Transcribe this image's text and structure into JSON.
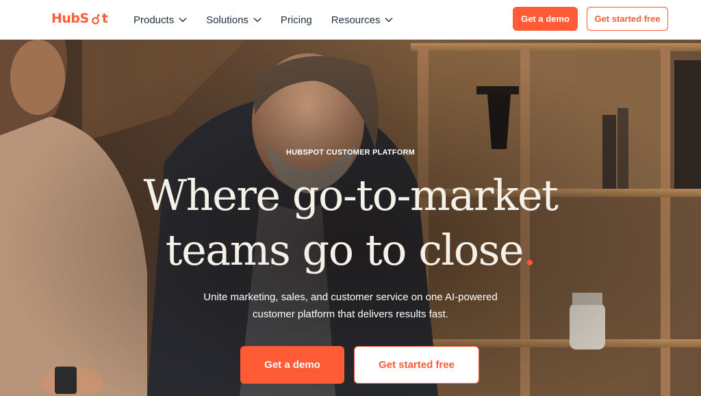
{
  "nav": {
    "logo_text_left": "HubS",
    "logo_text_right": "t",
    "items": [
      {
        "label": "Products",
        "has_dropdown": true
      },
      {
        "label": "Solutions",
        "has_dropdown": true
      },
      {
        "label": "Pricing",
        "has_dropdown": false
      },
      {
        "label": "Resources",
        "has_dropdown": true
      }
    ],
    "demo_label": "Get a demo",
    "free_label": "Get started free"
  },
  "hero": {
    "eyebrow": "HUBSPOT CUSTOMER PLATFORM",
    "headline_line1": "Where go-to-market",
    "headline_line2": "teams go to close",
    "headline_dot": ".",
    "subhead_line1": "Unite marketing, sales, and customer service on one AI-powered",
    "subhead_line2": "customer platform that delivers results fast.",
    "demo_label": "Get a demo",
    "free_label": "Get started free"
  },
  "colors": {
    "brand": "#ff5c35",
    "nav_text": "#213343",
    "hero_text": "#f6f1e8"
  },
  "icons": {
    "logo": "hubspot-sprocket-icon",
    "dropdown": "chevron-down-icon"
  }
}
